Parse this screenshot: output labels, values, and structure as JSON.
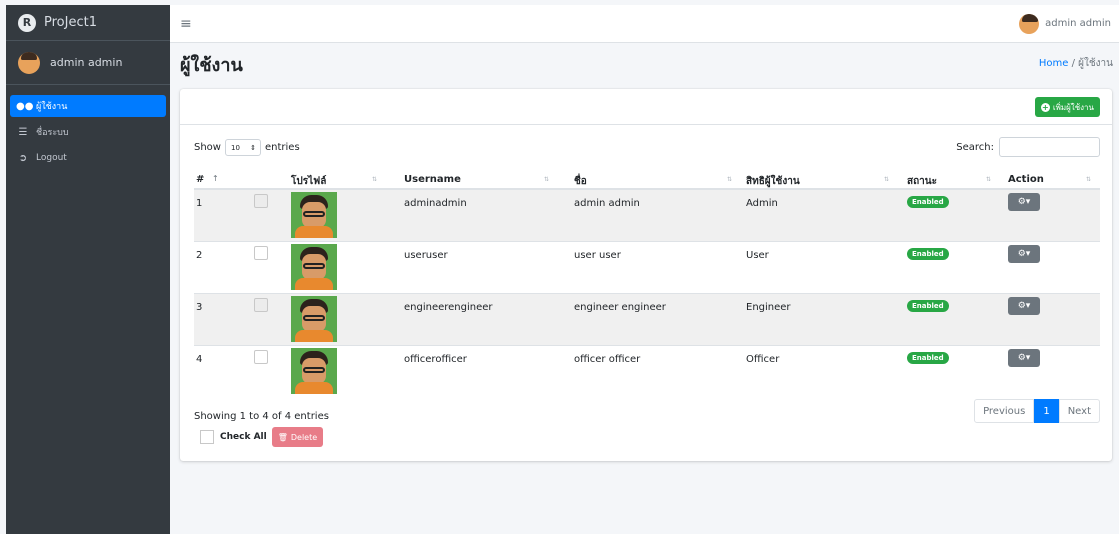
{
  "brand": {
    "logo": "R",
    "name": "ProJect1"
  },
  "sidebar": {
    "user": "admin admin",
    "items": [
      {
        "icon": "users-icon",
        "label": "ผู้ใช้งาน",
        "active": true
      },
      {
        "icon": "list-icon",
        "label": "ชื่อระบบ",
        "active": false
      },
      {
        "icon": "sign-out-icon",
        "label": "Logout",
        "active": false
      }
    ]
  },
  "topbar": {
    "user": "admin admin"
  },
  "page": {
    "title": "ผู้ใช้งาน",
    "breadcrumb_home": "Home",
    "breadcrumb_sep": "/",
    "breadcrumb_current": "ผู้ใช้งาน"
  },
  "card": {
    "add_button": "เพิ่มผู้ใช้งาน",
    "show_label": "Show",
    "show_value": "10",
    "entries_label": "entries",
    "search_label": "Search:",
    "search_value": ""
  },
  "table": {
    "headers": [
      "#",
      "โปรไฟล์",
      "Username",
      "ชื่อ",
      "สิทธิผู้ใช้งาน",
      "สถานะ",
      "Action"
    ],
    "rows": [
      {
        "no": "1",
        "username": "adminadmin",
        "name": "admin admin",
        "role": "Admin",
        "status": "Enabled"
      },
      {
        "no": "2",
        "username": "useruser",
        "name": "user user",
        "role": "User",
        "status": "Enabled"
      },
      {
        "no": "3",
        "username": "engineerengineer",
        "name": "engineer engineer",
        "role": "Engineer",
        "status": "Enabled"
      },
      {
        "no": "4",
        "username": "officerofficer",
        "name": "officer officer",
        "role": "Officer",
        "status": "Enabled"
      }
    ]
  },
  "footer": {
    "info": "Showing 1 to 4 of 4 entries",
    "check_all": "Check All",
    "delete": "Delete",
    "pager": {
      "previous": "Previous",
      "current": "1",
      "next": "Next"
    }
  },
  "colors": {
    "primary": "#007bff",
    "success": "#28a745",
    "sidebar": "#343a40",
    "danger_light": "#e87c88"
  }
}
